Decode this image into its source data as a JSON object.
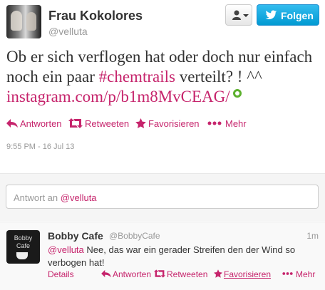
{
  "tweet": {
    "display_name": "Frau Kokolores",
    "screen_name": "@velluta",
    "text_before": "Ob er sich verflogen hat oder doch nur einfach noch ein paar ",
    "hashtag": "#chemtrails",
    "text_after": " verteilt? ! ^^ ",
    "link": "instagram.com/p/b1m8MvCEAG/",
    "timestamp": "9:55 PM - 16 Jul 13",
    "actions": {
      "reply": "Antworten",
      "retweet": "Retweeten",
      "favorite": "Favorisieren",
      "more": "Mehr"
    }
  },
  "header_buttons": {
    "follow_label": "Folgen"
  },
  "reply_box": {
    "prefix": "Antwort an ",
    "mention": "@velluta"
  },
  "reply_tweet": {
    "display_name": "Bobby Cafe",
    "screen_name": "@BobbyCafe",
    "time": "1m",
    "avatar_text_1": "Bobby",
    "avatar_text_2": "Cafe",
    "mention": "@velluta",
    "text": " Nee, das war ein gerader Streifen den der Wind so verbogen hat!",
    "actions": {
      "details": "Details",
      "reply": "Antworten",
      "retweet": "Retweeten",
      "favorite": "Favorisieren",
      "more": "Mehr"
    }
  },
  "colors": {
    "link": "#c6246c",
    "follow_button": "#019ad2",
    "media_indicator": "#5cb02d"
  }
}
